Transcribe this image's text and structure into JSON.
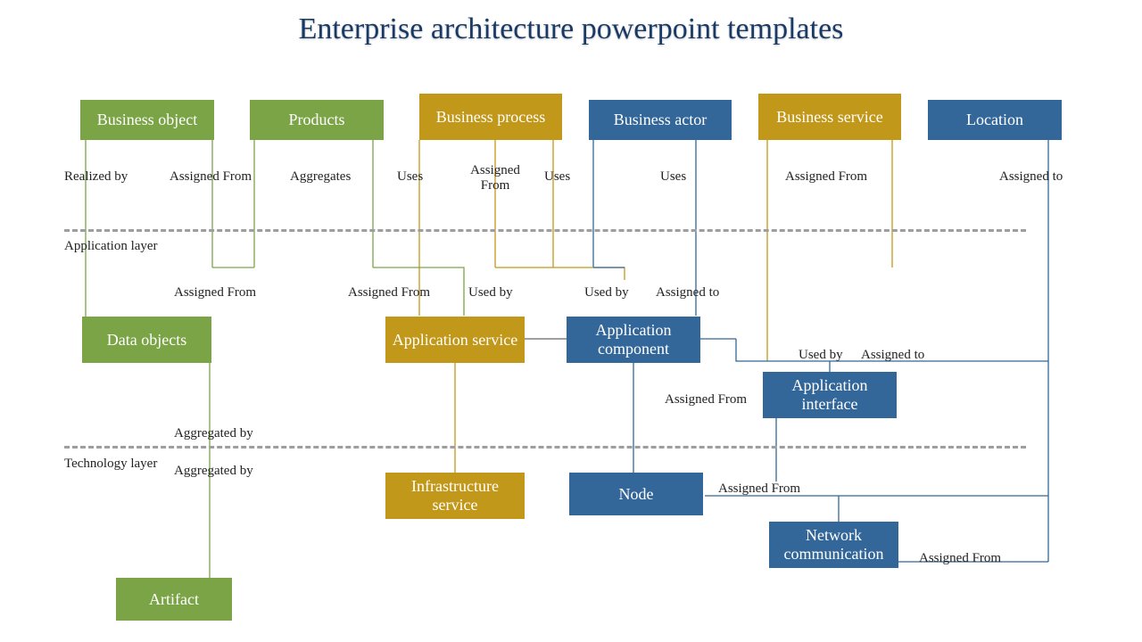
{
  "title": "Enterprise architecture powerpoint templates",
  "colors": {
    "green": "#7ba447",
    "gold": "#c2981a",
    "blue": "#336699",
    "dash": "#9e9e9e"
  },
  "boxes": {
    "business_object": "Business object",
    "products": "Products",
    "business_process": "Business process",
    "business_actor": "Business actor",
    "business_service": "Business service",
    "location": "Location",
    "data_objects": "Data objects",
    "application_service": "Application service",
    "application_component": "Application component",
    "application_interface": "Application interface",
    "infrastructure_service": "Infrastructure service",
    "node": "Node",
    "network_communication": "Network communication",
    "artifact": "Artifact"
  },
  "labels": {
    "realized_by": "Realized by",
    "assigned_from": "Assigned From",
    "assigned_from2": "Assigned From",
    "aggregates": "Aggregates",
    "uses": "Uses",
    "assigned_from3": "Assigned From",
    "uses2": "Uses",
    "uses3": "Uses",
    "assigned_from4": "Assigned From",
    "assigned_to": "Assigned to",
    "assigned_from5": "Assigned From",
    "assigned_from6": "Assigned From",
    "used_by": "Used by",
    "used_by2": "Used by",
    "assigned_to2": "Assigned to",
    "used_by3": "Used by",
    "assigned_to3": "Assigned to",
    "assigned_from7": "Assigned From",
    "aggregated_by": "Aggregated  by",
    "aggregated_by2": "Aggregated  by",
    "assigned_from8": "Assigned From",
    "assigned_from9": "Assigned From"
  },
  "layers": {
    "application": "Application layer",
    "technology": "Technology layer"
  }
}
